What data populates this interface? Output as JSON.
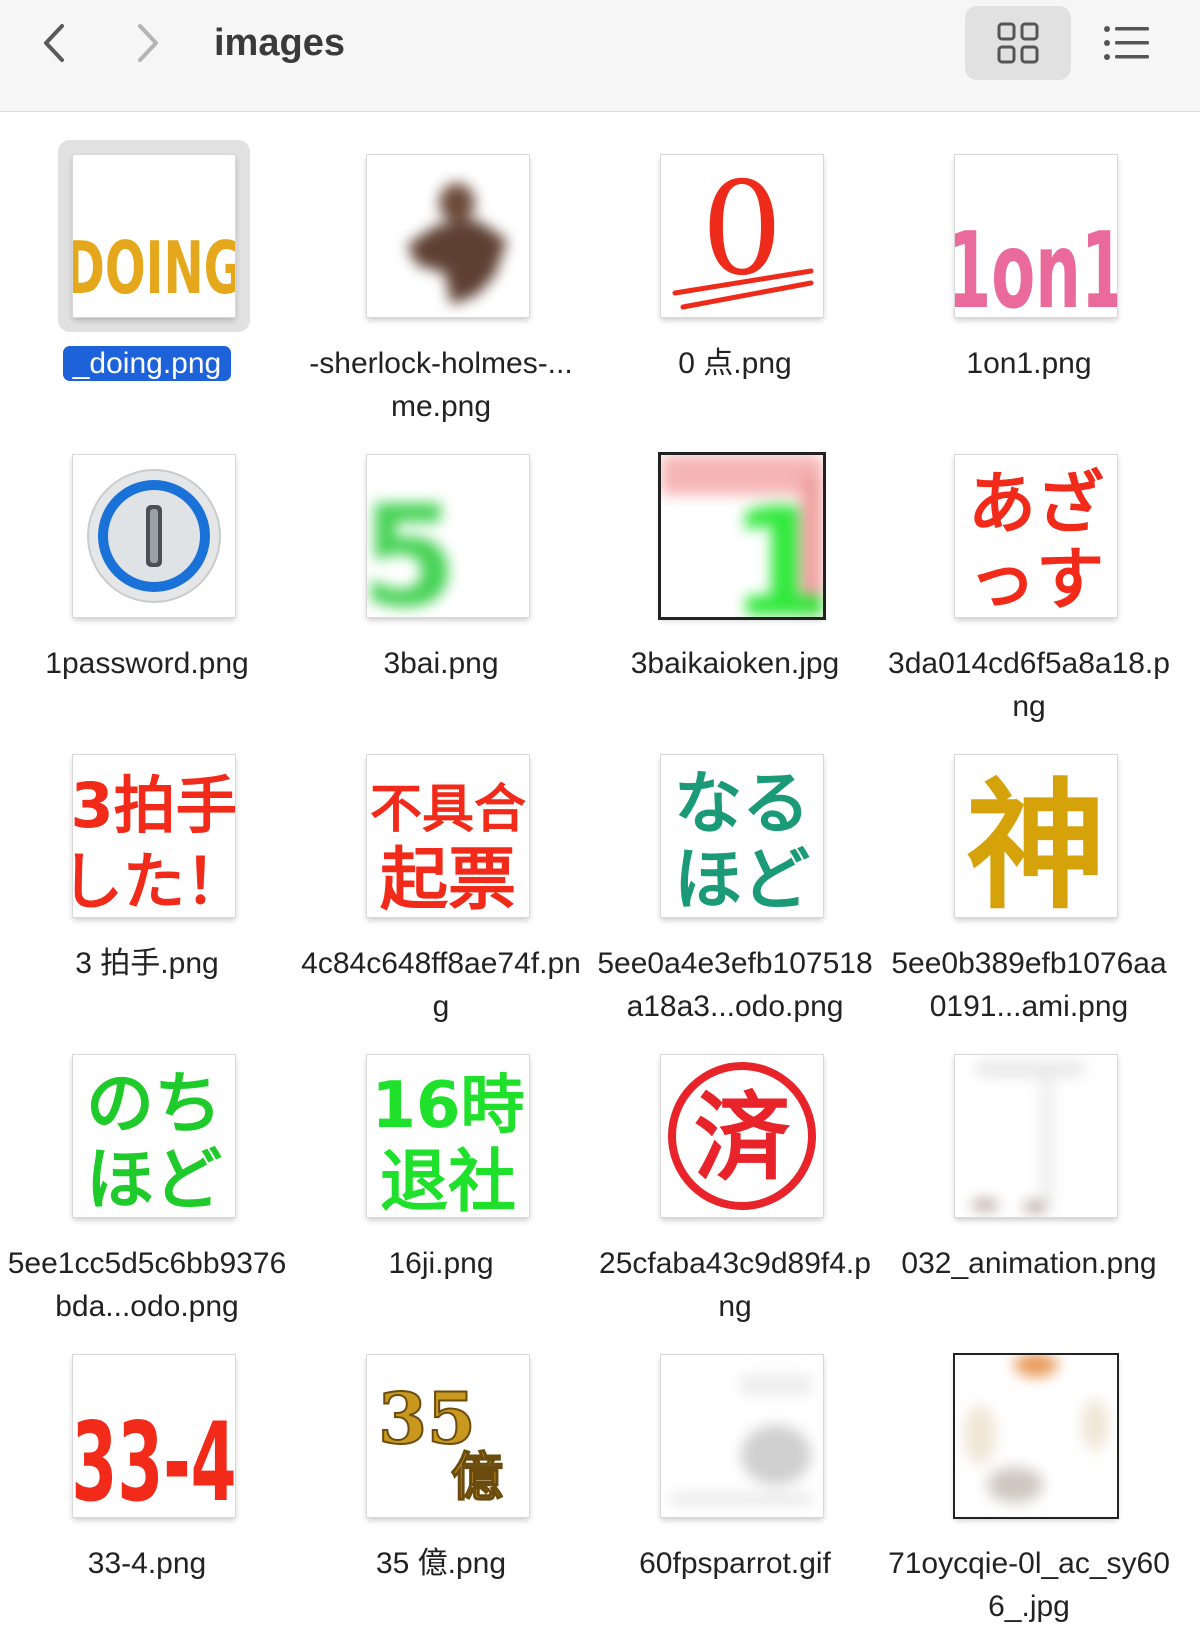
{
  "window": {
    "title": "images"
  },
  "toolbar": {
    "back_label": "<",
    "forward_label": ">",
    "grid_view": "icon-view",
    "list_view": "list-view"
  },
  "files": [
    {
      "name": "_doing.png",
      "thumb_text": "DOING",
      "selected": true
    },
    {
      "name": "-sherlock-holmes-...me.png",
      "thumb_text": ""
    },
    {
      "name": "0 点.png",
      "thumb_text": "0"
    },
    {
      "name": "1on1.png",
      "thumb_text": "1on1"
    },
    {
      "name": "1password.png",
      "thumb_text": ""
    },
    {
      "name": "3bai.png",
      "thumb_text": "5"
    },
    {
      "name": "3baikaioken.jpg",
      "thumb_text": "1"
    },
    {
      "name": "3da014cd6f5a8a18.png",
      "thumb_text": "あざっす"
    },
    {
      "name": "3 拍手.png",
      "thumb_text": "3拍手した！"
    },
    {
      "name": "4c84c648ff8ae74f.png",
      "thumb_text": "不具合起票"
    },
    {
      "name": "5ee0a4e3efb107518a18a3...odo.png",
      "thumb_text": "なるほど"
    },
    {
      "name": "5ee0b389efb1076aa0191...ami.png",
      "thumb_text": "神"
    },
    {
      "name": "5ee1cc5d5c6bb9376bda...odo.png",
      "thumb_text": "のちほど"
    },
    {
      "name": "16ji.png",
      "thumb_text": "16時退社"
    },
    {
      "name": "25cfaba43c9d89f4.png",
      "thumb_text": "済"
    },
    {
      "name": "032_animation.png",
      "thumb_text": ""
    },
    {
      "name": "33-4.png",
      "thumb_text": "33-4"
    },
    {
      "name": "35 億.png",
      "thumb_text": "35億"
    },
    {
      "name": "60fpsparrot.gif",
      "thumb_text": ""
    },
    {
      "name": "71oycqie-0l_ac_sy606_.jpg",
      "thumb_text": ""
    }
  ],
  "colors": {
    "selection": "#1d62d8",
    "toolbar_bg": "#f6f6f6"
  }
}
